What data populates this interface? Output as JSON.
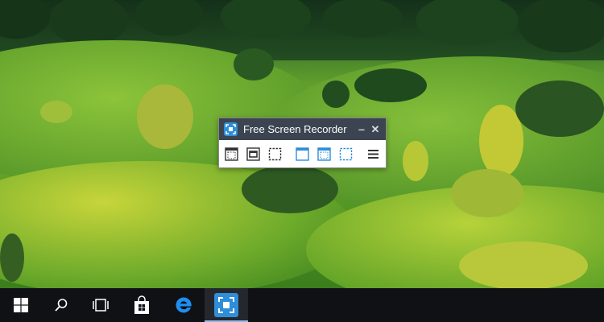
{
  "app": {
    "title": "Free Screen Recorder",
    "accent": "#2f8ed8",
    "titlebar_color": "#3b4450"
  },
  "window_controls": [
    {
      "name": "minimize-icon",
      "glyph": "‒"
    },
    {
      "name": "close-icon",
      "glyph": "✕"
    }
  ],
  "toolbar": {
    "tools": [
      {
        "name": "record-fullscreen-dotted",
        "icon": "dotted-frame-icon"
      },
      {
        "name": "record-window",
        "icon": "window-frame-icon"
      },
      {
        "name": "record-region",
        "icon": "dashed-rect-icon"
      },
      {
        "name": "screenshot-window",
        "icon": "window-icon"
      },
      {
        "name": "screenshot-fullscreen",
        "icon": "dotted-window-icon"
      },
      {
        "name": "screenshot-region",
        "icon": "dashed-rect-blue-icon"
      },
      {
        "name": "menu",
        "icon": "hamburger-menu-icon"
      }
    ]
  },
  "taskbar": {
    "background": "#0f1115",
    "items": [
      {
        "name": "start",
        "icon": "windows-logo-icon"
      },
      {
        "name": "search",
        "icon": "search-icon"
      },
      {
        "name": "task-view",
        "icon": "task-view-icon"
      },
      {
        "name": "store",
        "icon": "store-bag-icon"
      },
      {
        "name": "edge",
        "icon": "edge-browser-icon"
      },
      {
        "name": "screen-recorder",
        "icon": "screen-recorder-icon",
        "active": true
      }
    ]
  }
}
